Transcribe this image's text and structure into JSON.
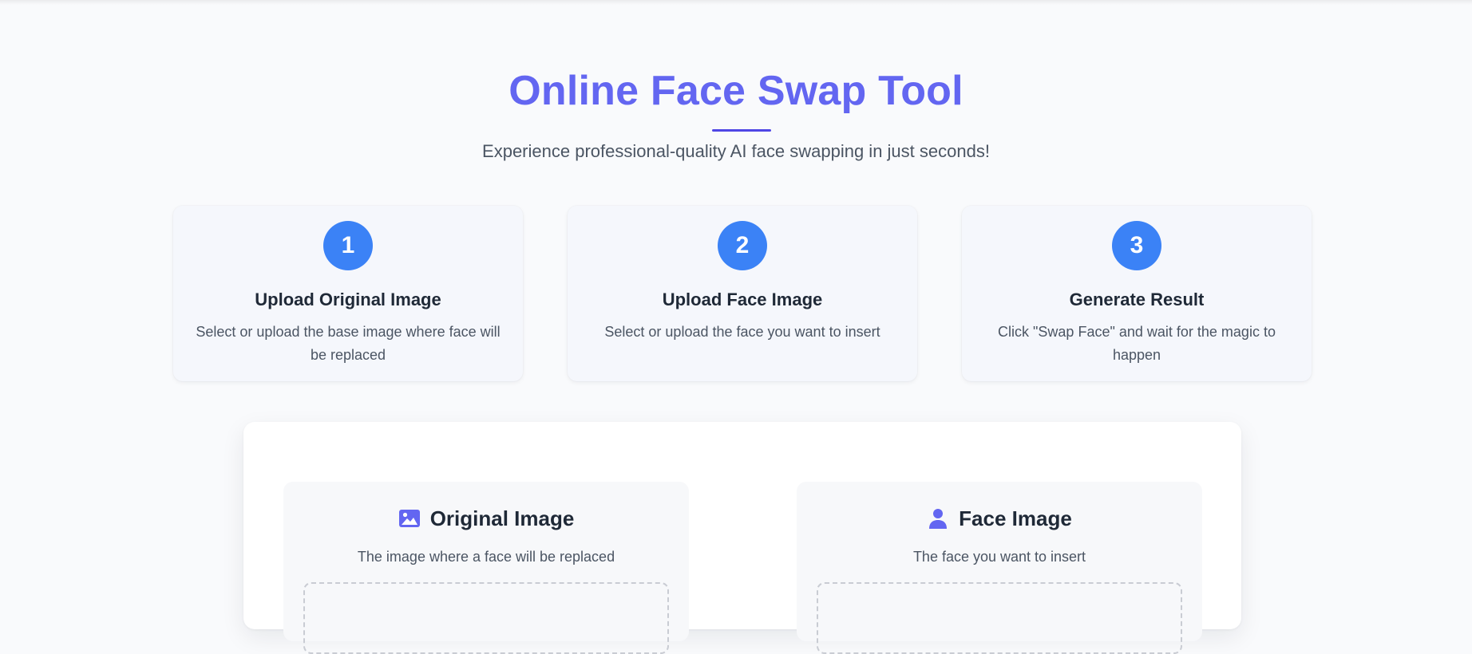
{
  "hero": {
    "title": "Online Face Swap Tool",
    "subtitle": "Experience professional-quality AI face swapping in just seconds!"
  },
  "steps": [
    {
      "number": "1",
      "title": "Upload Original Image",
      "description": "Select or upload the base image where face will be replaced"
    },
    {
      "number": "2",
      "title": "Upload Face Image",
      "description": "Select or upload the face you want to insert"
    },
    {
      "number": "3",
      "title": "Generate Result",
      "description": "Click \"Swap Face\" and wait for the magic to happen"
    }
  ],
  "uploads": {
    "original": {
      "icon": "image-icon",
      "title": "Original Image",
      "description": "The image where a face will be replaced"
    },
    "face": {
      "icon": "user-icon",
      "title": "Face Image",
      "description": "The face you want to insert"
    }
  },
  "colors": {
    "accent": "#6366f1",
    "step_badge": "#3b82f6",
    "background": "#f9fafc"
  }
}
